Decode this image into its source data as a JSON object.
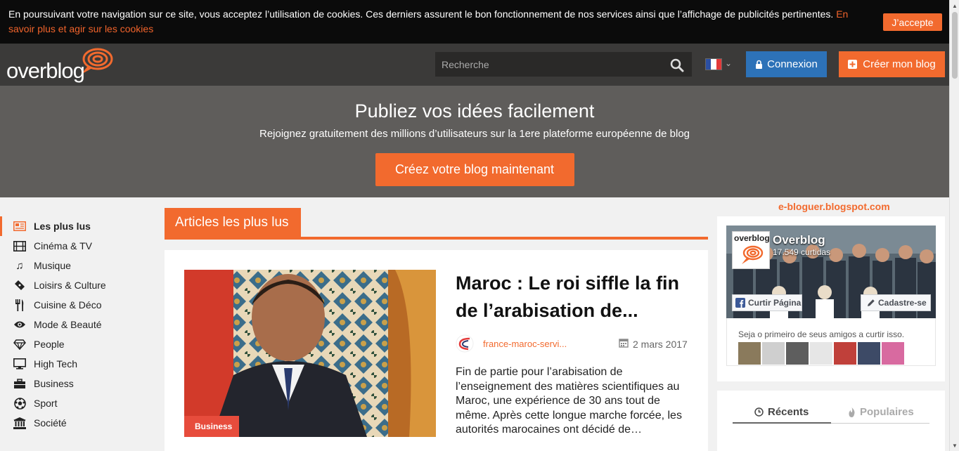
{
  "cookie": {
    "text": "En poursuivant votre navigation sur ce site, vous acceptez l’utilisation de cookies. Ces derniers assurent le bon fonctionnement de nos services ainsi que l’affichage de publicités pertinentes. ",
    "link": "En savoir plus et agir sur les cookies",
    "accept": "J’accepte"
  },
  "header": {
    "logo_text": "overblog",
    "search_placeholder": "Recherche",
    "connexion": "Connexion",
    "creer": "Créer mon blog"
  },
  "hero": {
    "title": "Publiez vos idées facilement",
    "subtitle": "Rejoignez gratuitement des millions d’utilisateurs sur la 1ere plateforme européenne de blog",
    "cta": "Créez votre blog maintenant"
  },
  "sidebar": {
    "items": [
      {
        "label": "Les plus lus",
        "icon": "newspaper-icon"
      },
      {
        "label": "Cinéma & TV",
        "icon": "film-icon"
      },
      {
        "label": "Musique",
        "icon": "music-icon"
      },
      {
        "label": "Loisirs & Culture",
        "icon": "ticket-icon"
      },
      {
        "label": "Cuisine & Déco",
        "icon": "cutlery-icon"
      },
      {
        "label": "Mode & Beauté",
        "icon": "eye-icon"
      },
      {
        "label": "People",
        "icon": "diamond-icon"
      },
      {
        "label": "High Tech",
        "icon": "monitor-icon"
      },
      {
        "label": "Business",
        "icon": "briefcase-icon"
      },
      {
        "label": "Sport",
        "icon": "soccer-ball-icon"
      },
      {
        "label": "Société",
        "icon": "institution-icon"
      }
    ]
  },
  "main": {
    "section_title": "Articles les plus lus",
    "article": {
      "badge": "Business",
      "title": "Maroc : Le roi siffle la fin de l’arabisation de...",
      "author": "france-maroc-servi...",
      "date": "2 mars 2017",
      "excerpt": "Fin de partie pour l’arabisation de l’enseignement des matières scientifiques au Maroc, une expérience de 30 ans tout de même. Après cette longue marche forcée, les autorités marocaines ont décidé de…"
    }
  },
  "right": {
    "watermark": "e-bloguer.blogspot.com",
    "fb": {
      "logo_text": "overblog",
      "name": "Overblog",
      "likes": "17.549 curtidas",
      "like_btn": "Curtir Página",
      "signup_btn": "Cadastre-se",
      "friends_text": "Seja o primeiro de seus amigos a curtir isso."
    },
    "tabs": {
      "recents": "Récents",
      "populaires": "Populaires"
    }
  },
  "colors": {
    "accent": "#f26a2e",
    "blue": "#2d72b8"
  }
}
